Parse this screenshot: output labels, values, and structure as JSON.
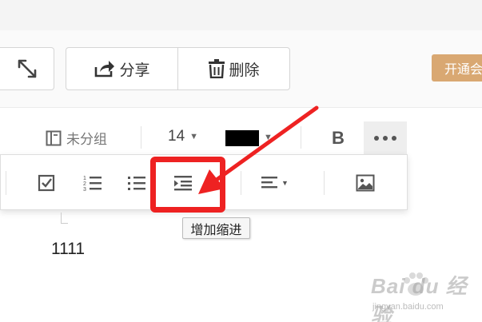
{
  "header": {
    "share_label": "分享",
    "delete_label": "删除",
    "open_membership_label": "开通会员"
  },
  "toolbar": {
    "group_label": "未分组",
    "font_size": "14",
    "font_color": "#000000"
  },
  "format_popup": {
    "buttons": [
      "checklist-icon",
      "numbered-list-icon",
      "bullet-list-icon",
      "increase-indent-icon",
      "align-icon",
      "image-icon"
    ],
    "highlighted": "increase-indent-icon",
    "tooltip": "增加缩进"
  },
  "editor": {
    "content": "1111"
  },
  "annotation": {
    "color": "#ee2222"
  },
  "watermark": {
    "logo": "Bai du 经验",
    "url": "jingyan.baidu.com"
  }
}
